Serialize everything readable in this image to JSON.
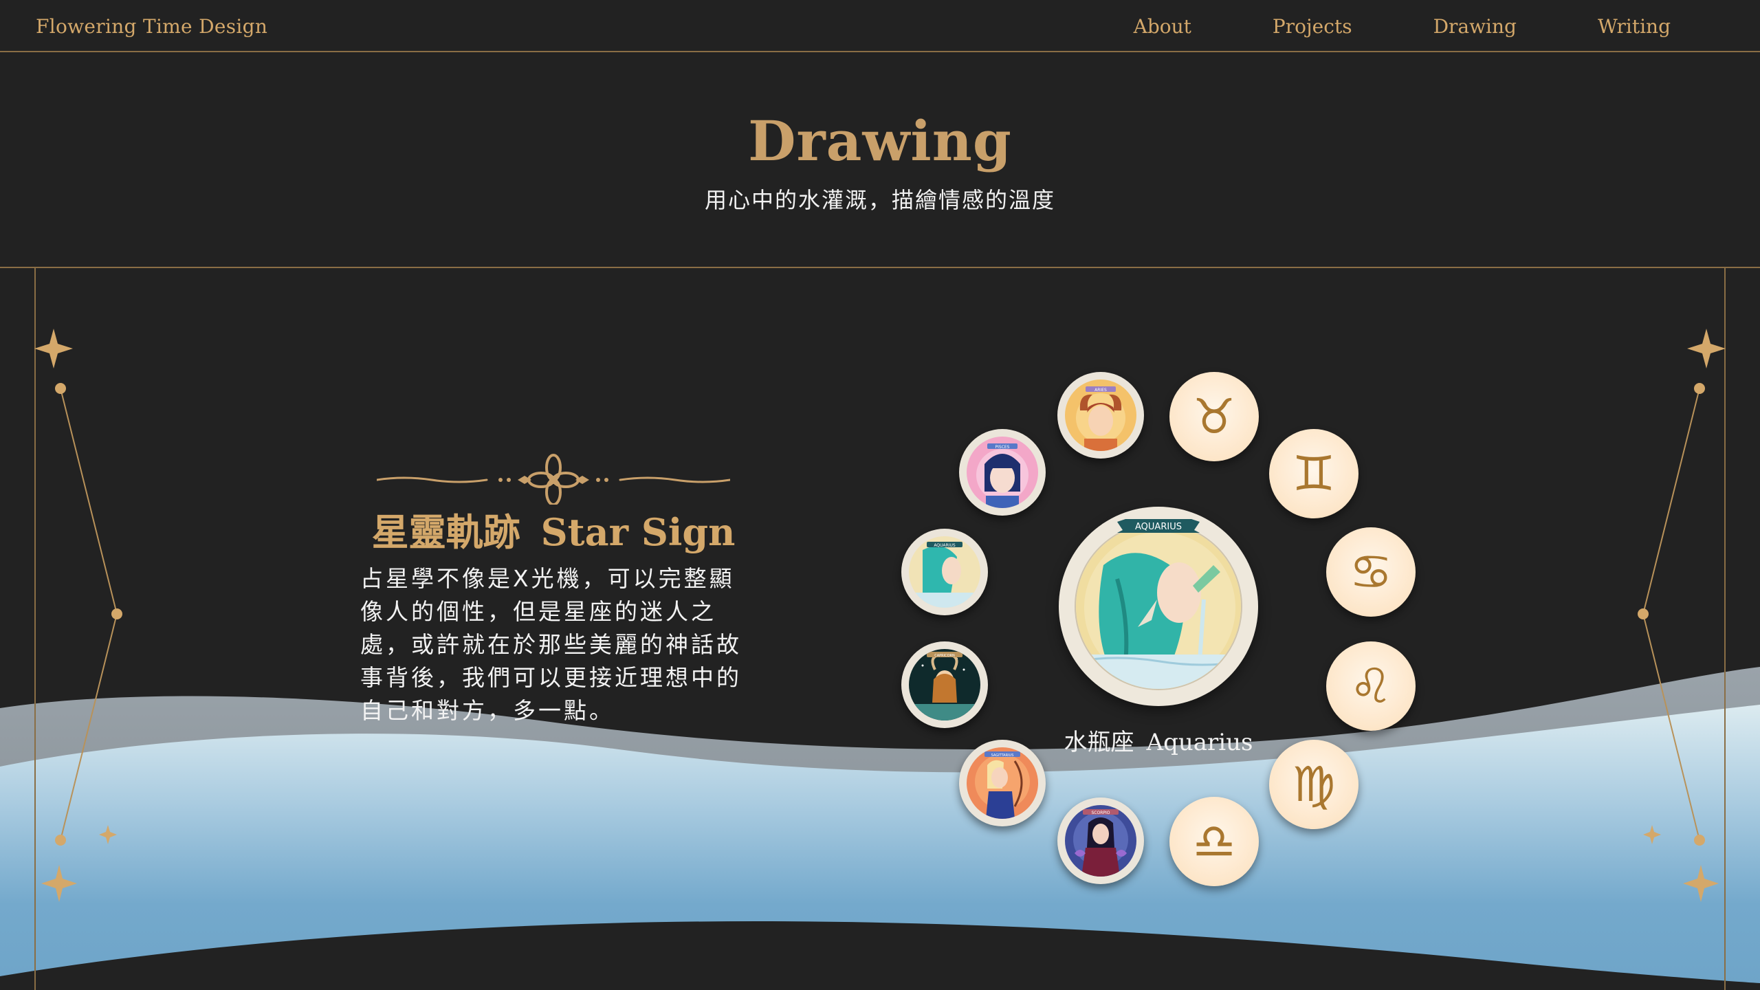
{
  "nav": {
    "brand": "Flowering Time Design",
    "links": [
      "About",
      "Projects",
      "Drawing",
      "Writing"
    ]
  },
  "hero": {
    "title": "Drawing",
    "subtitle": "用心中的水灌溉，描繪情感的溫度"
  },
  "section": {
    "title_zh": "星靈軌跡",
    "title_en": "Star Sign",
    "body": "占星學不像是X光機，可以完整顯像人的個性，但是星座的迷人之處，或許就在於那些美麗的神話故事背後，我們可以更接近理想中的自己和對方，多一點。"
  },
  "wheel": {
    "selected_zh": "水瓶座",
    "selected_en": "Aquarius",
    "center_banner": "AQUARIUS",
    "portraits": [
      {
        "sign": "aries",
        "banner": "ARIES"
      },
      {
        "sign": "pisces",
        "banner": "PISCES"
      },
      {
        "sign": "aquarius",
        "banner": "AQUARIUS"
      },
      {
        "sign": "capricorn",
        "banner": "CAPRICORN"
      },
      {
        "sign": "sagittarius",
        "banner": "SAGITTARIUS"
      },
      {
        "sign": "scorpio",
        "banner": "SCORPIO"
      }
    ],
    "symbols": [
      {
        "sign": "taurus",
        "glyph": "♉"
      },
      {
        "sign": "gemini",
        "glyph": "♊"
      },
      {
        "sign": "cancer",
        "glyph": "♋"
      },
      {
        "sign": "leo",
        "glyph": "♌"
      },
      {
        "sign": "virgo",
        "glyph": "♍"
      },
      {
        "sign": "libra",
        "glyph": "♎"
      }
    ]
  },
  "colors": {
    "background": "#222222",
    "gold": "#d4a86a",
    "cream": "#fde6c9",
    "wave_light": "#cfe3ec",
    "wave_blue": "#6fa6cb"
  }
}
